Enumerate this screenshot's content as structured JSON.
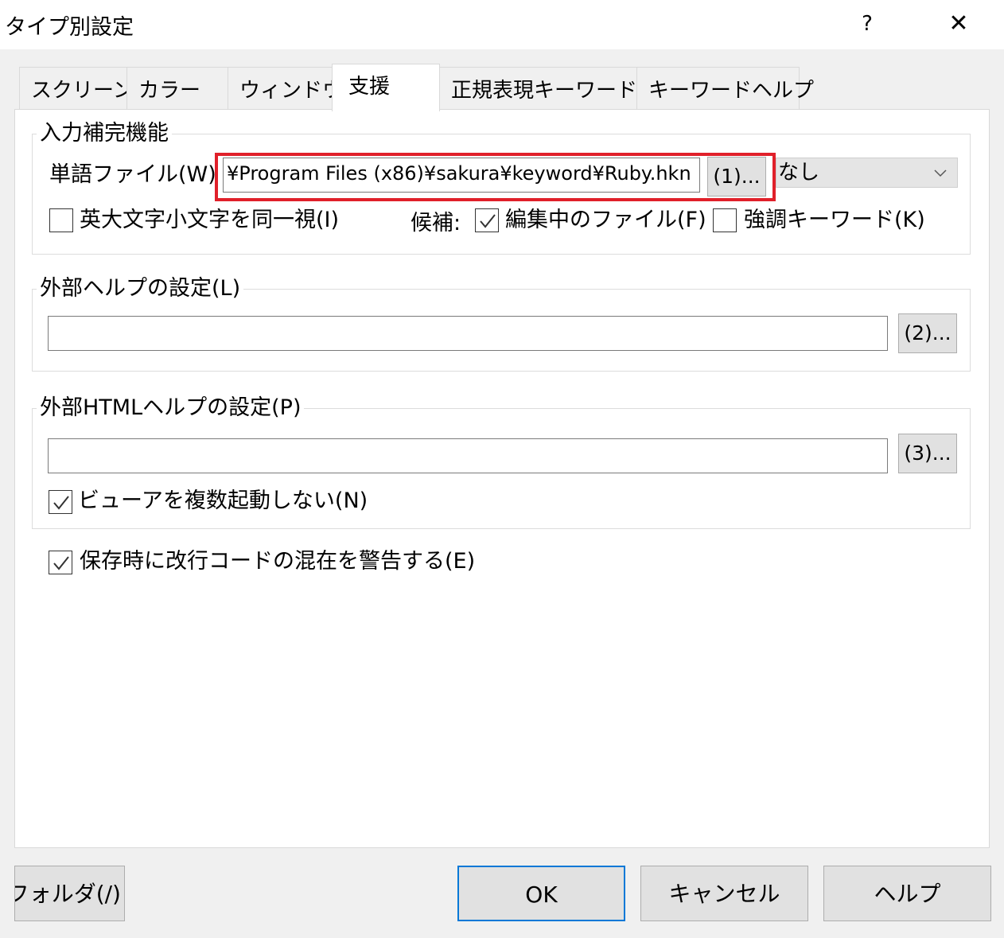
{
  "window": {
    "title": "タイプ別設定",
    "help_glyph": "?",
    "close_glyph": "✕"
  },
  "tabs": [
    "スクリーン",
    "カラー",
    "ウィンドウ",
    "支援",
    "正規表現キーワード",
    "キーワードヘルプ"
  ],
  "active_tab": "支援",
  "completion": {
    "group_title": "入力補完機能",
    "word_file_label": "単語ファイル(W)",
    "word_file_value": "¥Program Files (x86)¥sakura¥keyword¥Ruby.hkn",
    "browse_button": "(1)...",
    "plugin_select": "なし",
    "ignore_case_label": "英大文字小文字を同一視(I)",
    "ignore_case_checked": false,
    "candidates_label": "候補:",
    "editing_file_label": "編集中のファイル(F)",
    "editing_file_checked": true,
    "highlight_keyword_label": "強調キーワード(K)",
    "highlight_keyword_checked": false
  },
  "external_help": {
    "group_title": "外部ヘルプの設定(L)",
    "value": "",
    "browse_button": "(2)..."
  },
  "external_html_help": {
    "group_title": "外部HTMLヘルプの設定(P)",
    "value": "",
    "browse_button": "(3)...",
    "no_multi_viewer_label": "ビューアを複数起動しない(N)",
    "no_multi_viewer_checked": true
  },
  "warn_mixed_eol_label": "保存時に改行コードの混在を警告する(E)",
  "warn_mixed_eol_checked": true,
  "buttons": {
    "folder": "設定フォルダ(/)",
    "ok": "OK",
    "cancel": "キャンセル",
    "help": "ヘルプ"
  },
  "colors": {
    "highlight_box": "#e0202a",
    "ok_focus": "#0078d7"
  }
}
